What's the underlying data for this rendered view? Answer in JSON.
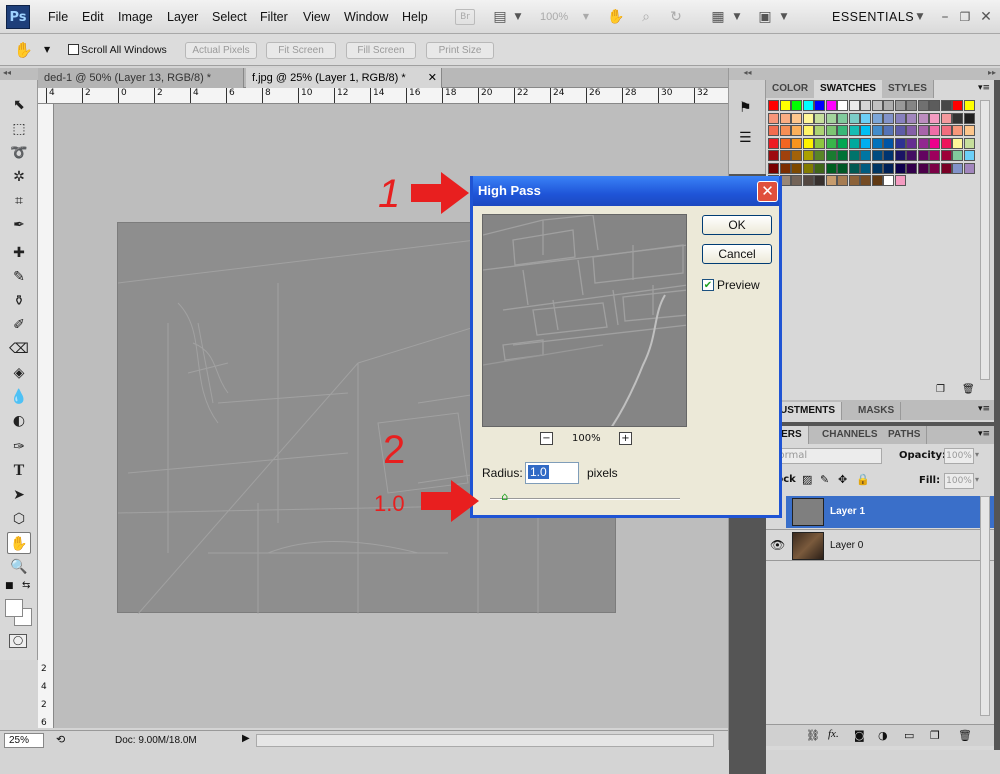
{
  "app": {
    "logo": "Ps",
    "workspace": "ESSENTIALS"
  },
  "menu": [
    "File",
    "Edit",
    "Image",
    "Layer",
    "Select",
    "Filter",
    "View",
    "Window",
    "Help"
  ],
  "toolbar_icons": {
    "br": "Br",
    "zoom_level": "100%"
  },
  "options": {
    "scroll_all": "Scroll All Windows",
    "actual_pixels": "Actual Pixels",
    "fit_screen": "Fit Screen",
    "fill_screen": "Fill Screen",
    "print_size": "Print Size"
  },
  "tabs": [
    {
      "label": "ded-1 @ 50% (Layer 13, RGB/8) *"
    },
    {
      "label": "f.jpg @ 25% (Layer 1, RGB/8) *"
    }
  ],
  "ruler_h": [
    "4",
    "2",
    "0",
    "2",
    "4",
    "6",
    "8",
    "10",
    "12",
    "14",
    "16",
    "18",
    "20",
    "22",
    "24",
    "26",
    "28",
    "30",
    "32"
  ],
  "ruler_v": [
    "2",
    "4",
    "2",
    "6"
  ],
  "status": {
    "zoom": "25%",
    "doc": "Doc: 9.00M/18.0M"
  },
  "panels": {
    "top_tabs": [
      "COLOR",
      "SWATCHES",
      "STYLES"
    ],
    "adj_tabs": [
      "ADJUSTMENTS",
      "MASKS"
    ],
    "layer_tabs": [
      "LAYERS",
      "CHANNELS",
      "PATHS"
    ],
    "blend_mode": "Normal",
    "opacity_label": "Opacity:",
    "opacity_value": "100%",
    "lock_label": "Lock:",
    "fill_label": "Fill:",
    "fill_value": "100%",
    "layers": [
      {
        "name": "Layer 1"
      },
      {
        "name": "Layer 0"
      }
    ]
  },
  "swatch_colors": [
    [
      "#ff0000",
      "#ffff00",
      "#00ff00",
      "#00ffff",
      "#0000ff",
      "#ff00ff",
      "#ffffff",
      "#ebebeb",
      "#d6d6d6",
      "#c2c2c2",
      "#adadad",
      "#999999",
      "#858585",
      "#707070",
      "#5c5c5c",
      "#474747",
      "#ff0000",
      "#ffff00"
    ],
    [
      "#f7977a",
      "#fbad82",
      "#fdc68c",
      "#fff799",
      "#c6df9c",
      "#a4d49d",
      "#81ca9d",
      "#7bcdc8",
      "#6ccff7",
      "#7ca6d8",
      "#8293ca",
      "#8881be",
      "#a286bd",
      "#bc8cbf",
      "#f49bc1",
      "#f5999d",
      "#333333",
      "#1f1f1f"
    ],
    [
      "#f26c4f",
      "#f68e55",
      "#fbaf5a",
      "#fff467",
      "#acd372",
      "#7dc473",
      "#39b778",
      "#16bcb4",
      "#00bff3",
      "#438ccb",
      "#5573b7",
      "#5e5ca7",
      "#855fa8",
      "#a763a9",
      "#ef6ea8",
      "#f16d7e",
      "#f7977a",
      "#fdc68c"
    ],
    [
      "#ed1c24",
      "#f26522",
      "#f7941d",
      "#fff200",
      "#8dc63f",
      "#39b54a",
      "#00a651",
      "#00a99d",
      "#00aeef",
      "#0072bc",
      "#0054a6",
      "#2e3192",
      "#662d91",
      "#92278f",
      "#ec008c",
      "#ed145b",
      "#fff799",
      "#c6df9c"
    ],
    [
      "#9e0b0f",
      "#a0410d",
      "#a36209",
      "#aba000",
      "#598527",
      "#1a7b30",
      "#007236",
      "#00746b",
      "#0076a3",
      "#004b80",
      "#003471",
      "#1b1464",
      "#440e62",
      "#630460",
      "#9e005d",
      "#9e0039",
      "#81ca9d",
      "#6ccff7"
    ],
    [
      "#790000",
      "#7b2e00",
      "#7d4900",
      "#827b00",
      "#406618",
      "#005e20",
      "#005826",
      "#005952",
      "#005b7f",
      "#003663",
      "#002157",
      "#0d004c",
      "#32004b",
      "#4b0049",
      "#7b0046",
      "#7a0026",
      "#8293ca",
      "#a286bd"
    ],
    [
      "#c7b299",
      "#998675",
      "#736357",
      "#534741",
      "#37302d",
      "#c69c6d",
      "#a67c52",
      "#8c6239",
      "#754c24",
      "#603913",
      "#ffffff",
      "#f49bc1"
    ]
  ],
  "dialog": {
    "title": "High Pass",
    "ok": "OK",
    "cancel": "Cancel",
    "preview_label": "Preview",
    "zoom_value": "100%",
    "radius_label": "Radius:",
    "radius_value": "1.0",
    "radius_unit": "pixels",
    "slider_fraction": 0.06
  },
  "annotations": {
    "step1": "1",
    "step2": "2",
    "value": "1.0"
  },
  "colors": {
    "annotation": "#e81f1f",
    "dialog_title": "#1f55d8",
    "layer_selected": "#3a6fc9"
  }
}
